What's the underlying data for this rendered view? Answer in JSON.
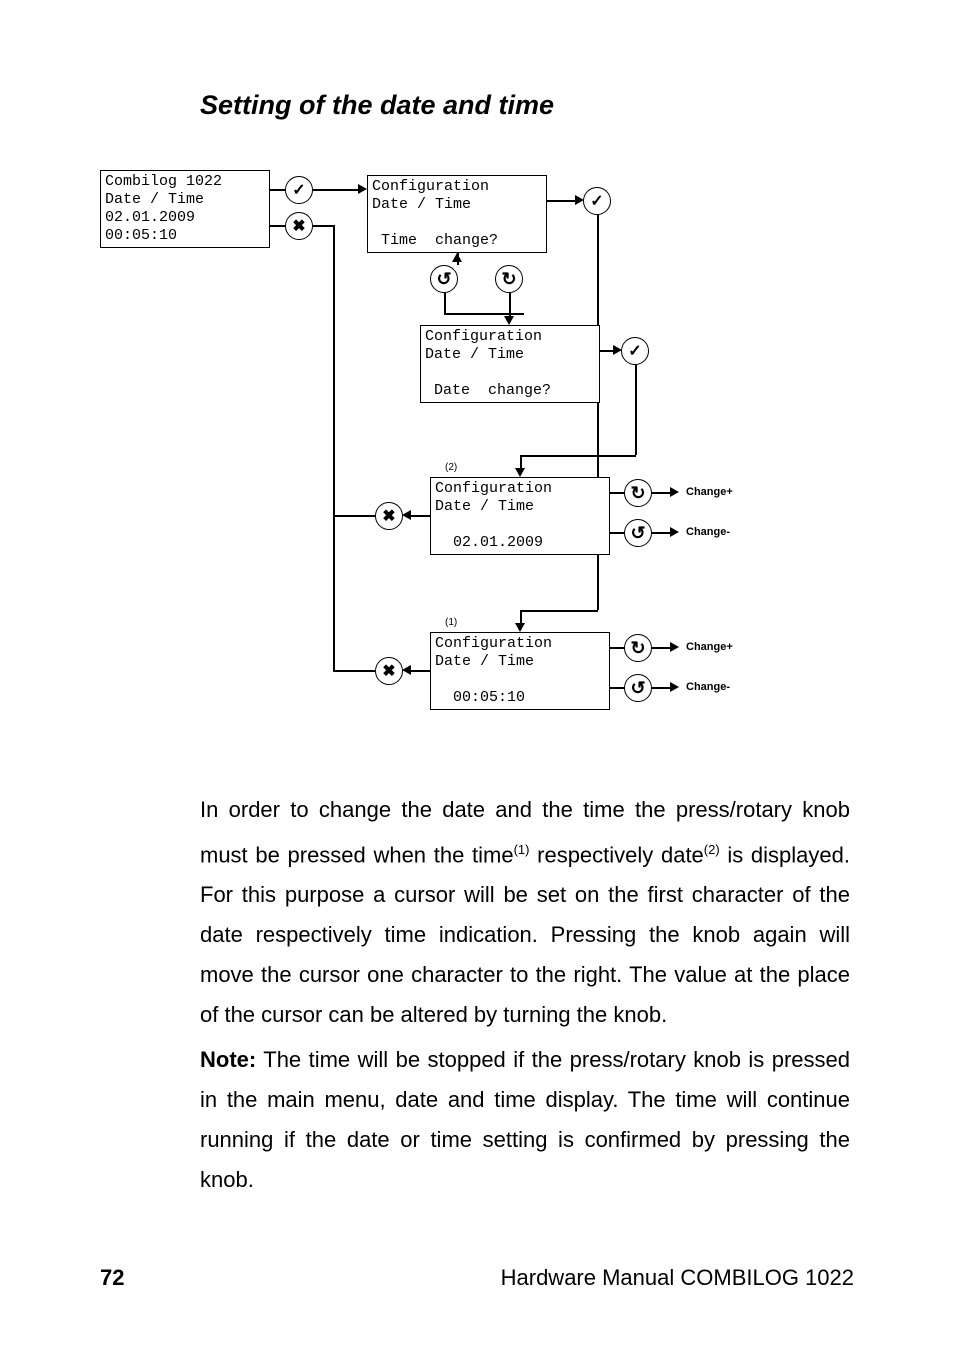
{
  "heading": "Setting of the date and time",
  "box_main": "Combilog 1022\nDate / Time\n02.01.2009\n00:05:10",
  "box_time_change": "Configuration\nDate / Time\n\n Time  change?",
  "box_date_change": "Configuration\nDate / Time\n\n Date  change?",
  "box_date_edit": "Configuration\nDate / Time\n\n  02.01.2009",
  "box_time_edit": "Configuration\nDate / Time\n\n  00:05:10",
  "sup2": "(2)",
  "sup1": "(1)",
  "label_change_plus": "Change+",
  "label_change_minus": "Change-",
  "glyph_check": "✓",
  "glyph_cross": "✖",
  "glyph_rot_cw": "↻",
  "glyph_rot_ccw": "↺",
  "para1_a": "In order to change the date and the time the press/rotary knob must be pressed when the time",
  "para1_sup1": "(1)",
  "para1_b": " respectively date",
  "para1_sup2": "(2)",
  "para1_c": " is displayed. For this purpose a cursor will be set on the first character of the date respectively time indication. Pressing the knob again will move the cursor one character to the right. The value at the place of the cursor can be altered by turning the knob.",
  "para2_label": "Note:",
  "para2": " The time will be stopped if the press/rotary knob is pressed in the main menu, date and time display. The time will continue running if the date or time setting is confirmed by pressing the knob.",
  "page_number": "72",
  "footer": "Hardware Manual COMBILOG 1022"
}
